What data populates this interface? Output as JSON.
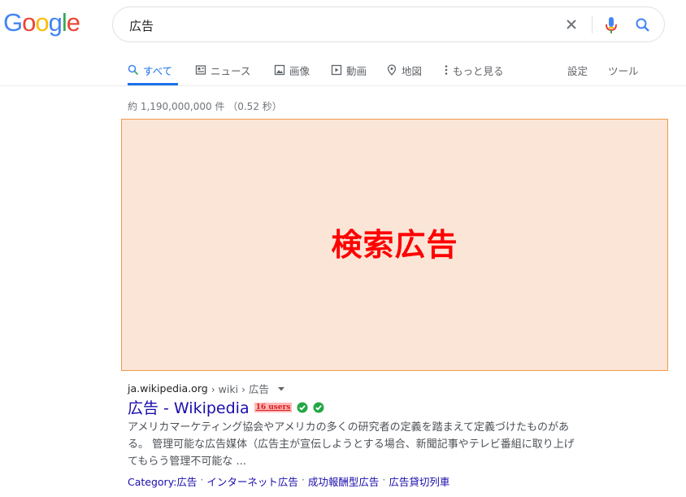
{
  "logo": {
    "letters": [
      "G",
      "o",
      "o",
      "g",
      "l",
      "e"
    ],
    "colors": [
      "#4285F4",
      "#EA4335",
      "#FBBC05",
      "#4285F4",
      "#34A853",
      "#EA4335"
    ]
  },
  "search": {
    "query": "広告"
  },
  "tabs": [
    {
      "label": "すべて",
      "icon": "search-icon",
      "active": true
    },
    {
      "label": "ニュース",
      "icon": "news-icon",
      "active": false
    },
    {
      "label": "画像",
      "icon": "image-icon",
      "active": false
    },
    {
      "label": "動画",
      "icon": "video-icon",
      "active": false
    },
    {
      "label": "地図",
      "icon": "map-pin-icon",
      "active": false
    },
    {
      "label": "もっと見る",
      "icon": "more-vertical-icon",
      "active": false
    }
  ],
  "tools": {
    "settings": "設定",
    "tools": "ツール"
  },
  "stats": "約 1,190,000,000 件 （0.52 秒）",
  "ad": {
    "label": "検索広告"
  },
  "result": {
    "domain": "ja.wikipedia.org",
    "path": " › wiki › 広告",
    "title": "広告 - Wikipedia",
    "users_badge": "16 users",
    "snippet_lines": [
      "アメリカマーケティング協会やアメリカの多くの研究者の定義を踏まえて定義づけたものがあ",
      "る。 管理可能な広告媒体（広告主が宣伝しようとする場合、新聞記事やテレビ番組に取り上げ",
      "てもらう管理不可能な ..."
    ],
    "sitelinks": [
      "Category:広告",
      "インターネット広告",
      "成功報酬型広告",
      "広告貸切列車"
    ],
    "sitelink_separator": "·"
  },
  "colors": {
    "accent": "#1a73e8",
    "link": "#1a0dab",
    "ad_fill": "#fbe5d7",
    "ad_border": "#f2994a",
    "ad_text": "#ff0000"
  }
}
